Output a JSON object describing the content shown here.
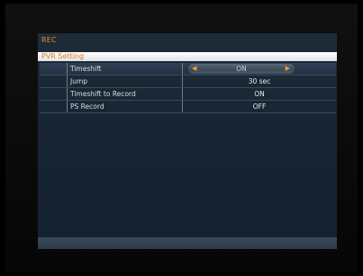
{
  "menu": {
    "title": "REC",
    "subtitle": "PVR Setting"
  },
  "settings": [
    {
      "label": "Timeshift",
      "value": "ON",
      "selected": true
    },
    {
      "label": "Jump",
      "value": "30 sec",
      "selected": false
    },
    {
      "label": "Timeshift to Record",
      "value": "ON",
      "selected": false
    },
    {
      "label": "PS Record",
      "value": "OFF",
      "selected": false
    }
  ],
  "icons": {
    "left_arrow": "chevron-left-icon",
    "right_arrow": "chevron-right-icon"
  },
  "colors": {
    "accent": "#f08a2a",
    "panel": "#1a2736"
  }
}
